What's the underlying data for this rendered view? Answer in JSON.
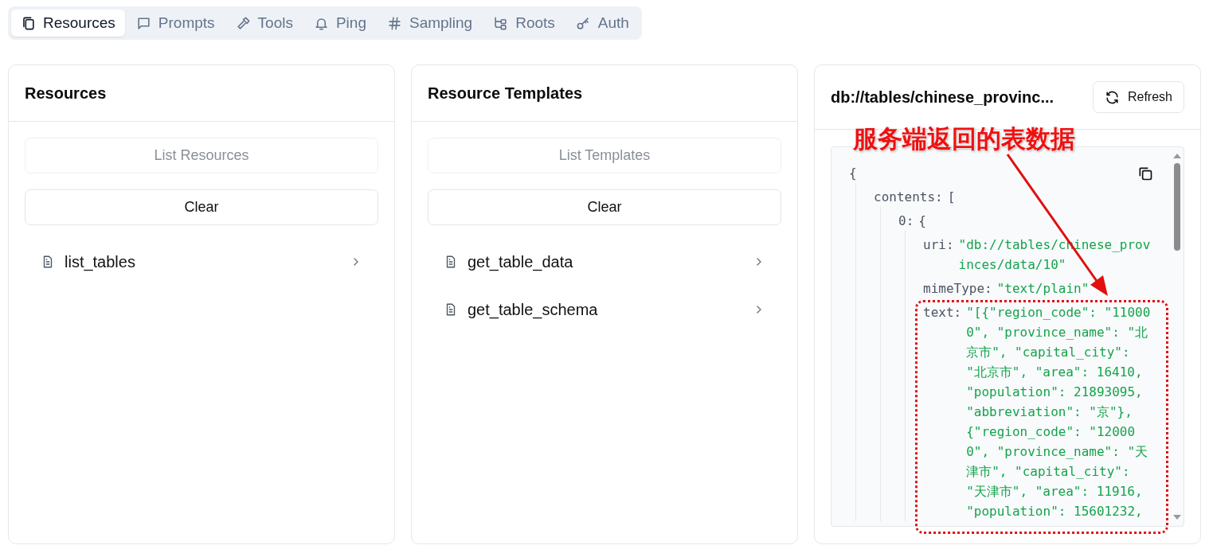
{
  "tabs": [
    {
      "label": "Resources",
      "selected": true
    },
    {
      "label": "Prompts",
      "selected": false
    },
    {
      "label": "Tools",
      "selected": false
    },
    {
      "label": "Ping",
      "selected": false
    },
    {
      "label": "Sampling",
      "selected": false
    },
    {
      "label": "Roots",
      "selected": false
    },
    {
      "label": "Auth",
      "selected": false
    }
  ],
  "panels": [
    {
      "title": "Resources",
      "list_button": {
        "label": "List Resources",
        "disabled": true
      },
      "clear_button": {
        "label": "Clear",
        "disabled": false
      },
      "items": [
        {
          "label": "list_tables"
        }
      ]
    },
    {
      "title": "Resource Templates",
      "list_button": {
        "label": "List Templates",
        "disabled": true
      },
      "clear_button": {
        "label": "Clear",
        "disabled": false
      },
      "items": [
        {
          "label": "get_table_data"
        },
        {
          "label": "get_table_schema"
        }
      ]
    }
  ],
  "detail": {
    "title": "db://tables/chinese_provinc...",
    "refresh_button": {
      "label": "Refresh"
    },
    "tree": {
      "open": "{",
      "children": [
        {
          "key": "contents:",
          "open": "[",
          "children": [
            {
              "key": "0:",
              "open": "{",
              "children": [
                {
                  "key": "uri:",
                  "value_lines": [
                    "\"db://tables/chinese_prov",
                    "inces/data/10\""
                  ]
                },
                {
                  "key": "mimeType:",
                  "value_lines": [
                    "\"text/plain\""
                  ]
                },
                {
                  "key": "text:",
                  "value_lines": [
                    "\"[{\"region_code\": \"11000",
                    "0\", \"province_name\": \"北",
                    "京市\", \"capital_city\":",
                    "\"北京市\", \"area\": 16410,",
                    "\"population\": 21893095,",
                    "\"abbreviation\": \"京\"},",
                    "{\"region_code\": \"12000",
                    "0\", \"province_name\": \"天",
                    "津市\", \"capital_city\":",
                    "\"天津市\", \"area\": 11916,",
                    "\"population\": 15601232,"
                  ]
                }
              ]
            }
          ]
        }
      ]
    }
  },
  "annotation": {
    "label": "服务端返回的表数据"
  }
}
